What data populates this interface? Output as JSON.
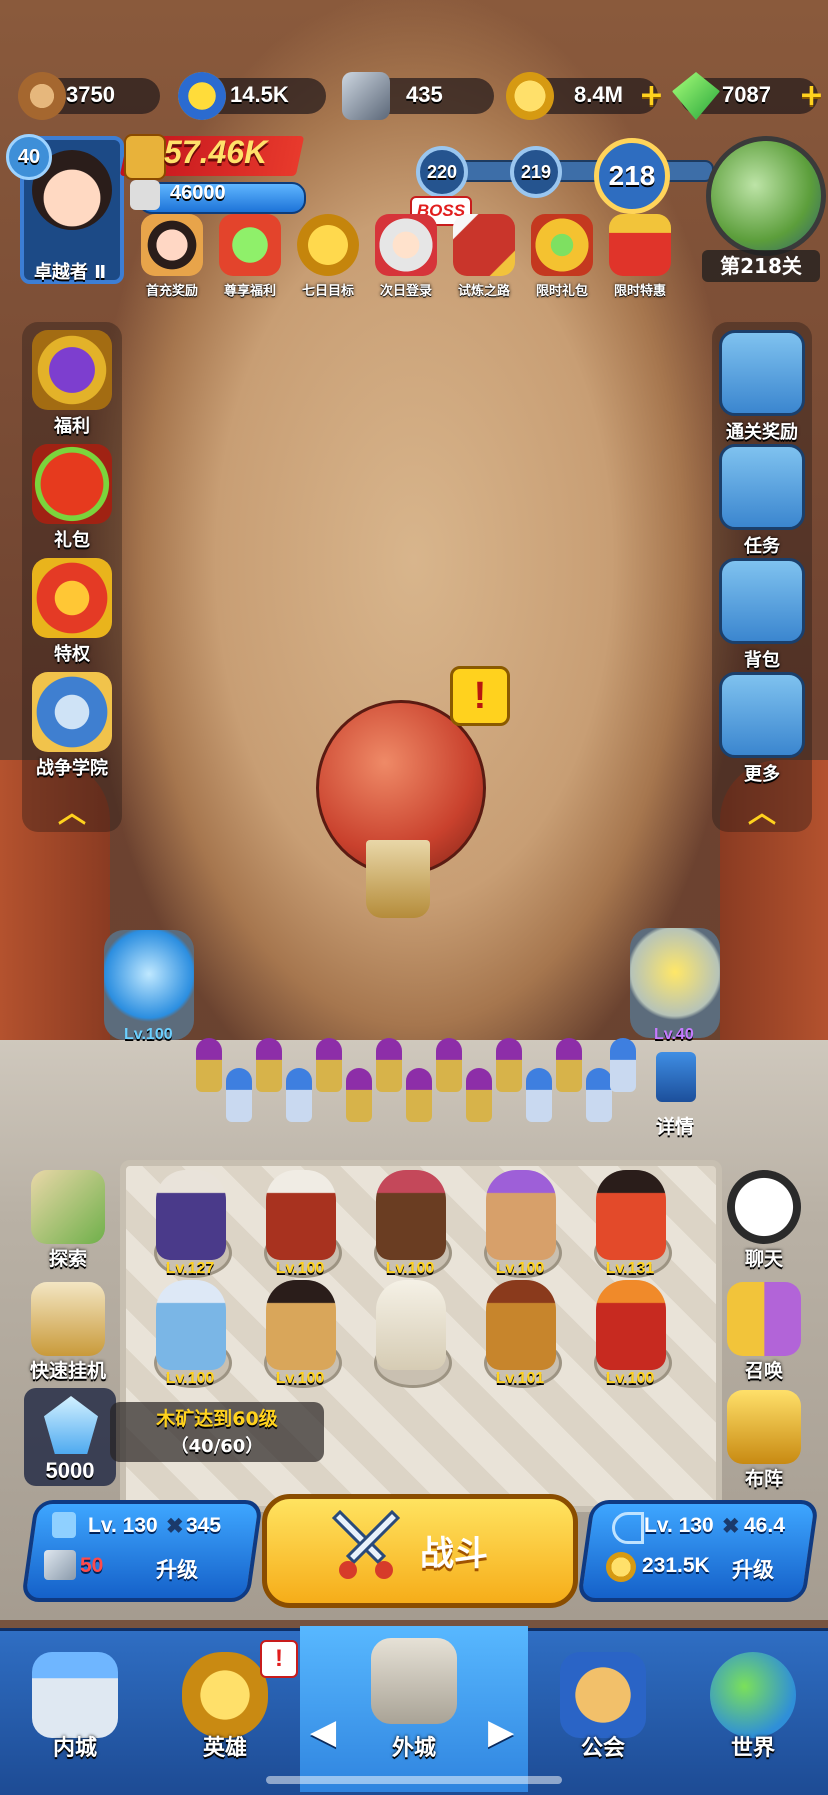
{
  "resources": [
    {
      "name": "wood",
      "value": "3750",
      "icon": "wood-log-icon"
    },
    {
      "name": "star-coin",
      "value": "14.5K",
      "icon": "star-medal-icon"
    },
    {
      "name": "iron",
      "value": "435",
      "icon": "iron-ore-icon"
    },
    {
      "name": "gold",
      "value": "8.4M",
      "icon": "gold-coin-icon"
    },
    {
      "name": "gem",
      "value": "7087",
      "icon": "green-gem-icon"
    }
  ],
  "player": {
    "level": "40",
    "rank": "卓越者 Ⅱ",
    "power": "57.46K",
    "hp": "46000"
  },
  "stage": {
    "nodes": [
      "220",
      "219"
    ],
    "current": "218",
    "boss_label": "BOSS",
    "current_label": "第218关"
  },
  "events": [
    {
      "label": "首充奖励",
      "icon": "first-recharge-girl-icon"
    },
    {
      "label": "尊享福利",
      "icon": "gem-gift-icon"
    },
    {
      "label": "七日目标",
      "icon": "seven-day-medal-icon"
    },
    {
      "label": "次日登录",
      "icon": "old-wizard-icon"
    },
    {
      "label": "试炼之路",
      "icon": "crossed-swords-icon"
    },
    {
      "label": "限时礼包",
      "icon": "crown-gift-icon"
    },
    {
      "label": "限时特惠",
      "icon": "gift-box-icon"
    }
  ],
  "left_menu": [
    {
      "label": "福利",
      "icon": "crown-shield-icon"
    },
    {
      "label": "礼包",
      "icon": "gift-icon"
    },
    {
      "label": "特权",
      "icon": "privilege-crown-icon"
    },
    {
      "label": "战争学院",
      "icon": "war-academy-icon"
    }
  ],
  "right_menu": [
    {
      "label": "通关奖励",
      "icon": "gift-box-icon"
    },
    {
      "label": "任务",
      "icon": "scroll-icon"
    },
    {
      "label": "背包",
      "icon": "backpack-icon"
    },
    {
      "label": "更多",
      "icon": "plus-icon"
    }
  ],
  "alert_symbol": "!",
  "towers": {
    "left_level": "Lv.100",
    "right_level": "Lv.40",
    "details_label": "详情"
  },
  "heroes_row1": [
    "Lv.127",
    "Lv.100",
    "Lv.100",
    "Lv.100",
    "Lv.131"
  ],
  "heroes_row2": [
    "Lv.100",
    "Lv.100",
    "",
    "Lv.101",
    "Lv.100"
  ],
  "left_actions": [
    {
      "label": "探索",
      "icon": "explore-map-icon"
    },
    {
      "label": "快速挂机",
      "icon": "hourglass-icon"
    }
  ],
  "right_actions": [
    {
      "label": "聊天",
      "icon": "chat-bubble-icon"
    },
    {
      "label": "召唤",
      "icon": "summon-cards-icon"
    },
    {
      "label": "布阵",
      "icon": "formation-chess-icon"
    }
  ],
  "quest": {
    "title": "木矿达到60级",
    "progress": "（40/60）",
    "crystal": "5000"
  },
  "upgrade_left": {
    "level": "Lv. 130",
    "power": "345",
    "cost": "50",
    "action": "升级"
  },
  "upgrade_right": {
    "level": "Lv. 130",
    "power": "46.4",
    "cost": "231.5K",
    "action": "升级"
  },
  "fight_label": "战斗",
  "nav": [
    {
      "label": "内城",
      "icon": "inner-castle-icon"
    },
    {
      "label": "英雄",
      "icon": "hero-helmet-icon"
    },
    {
      "label": "外城",
      "icon": "outer-castle-icon"
    },
    {
      "label": "公会",
      "icon": "guild-handshake-icon"
    },
    {
      "label": "世界",
      "icon": "world-globe-icon"
    }
  ],
  "colors": {
    "accent_gold": "#ffd21e",
    "nav_blue": "#2f6ec3",
    "power_red": "#d41d1d"
  }
}
